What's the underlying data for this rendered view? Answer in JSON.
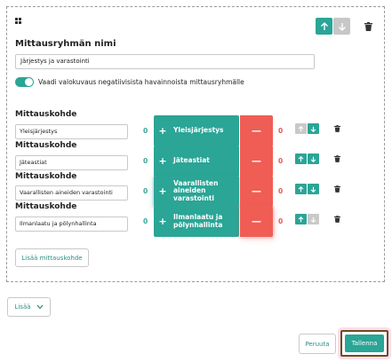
{
  "group": {
    "title": "Mittausryhmän nimi",
    "name_value": "Järjestys ja varastointi",
    "toggle_label": "Vaadi valokuvaus negatiivisista havainnoista mittausryhmälle",
    "toggle_on": true
  },
  "items": [
    {
      "label": "Mittauskohde",
      "value": "Yleisjärjestys",
      "pos_count": "0",
      "neg_count": "0",
      "button_text": "Yleisjärjestys",
      "plus": "+",
      "minus": "—"
    },
    {
      "label": "Mittauskohde",
      "value": "Jäteastiat",
      "pos_count": "0",
      "neg_count": "0",
      "button_text": "Jäteastiat",
      "plus": "+",
      "minus": "—"
    },
    {
      "label": "Mittauskohde",
      "value": "Vaarallisten aineiden varastointi",
      "pos_count": "0",
      "neg_count": "0",
      "button_text": "Vaarallisten aineiden varastointi",
      "plus": "+",
      "minus": "—"
    },
    {
      "label": "Mittauskohde",
      "value": "Ilmanlaatu ja pölynhallinta",
      "pos_count": "0",
      "neg_count": "0",
      "button_text": "Ilmanlaatu ja pölynhallinta",
      "plus": "+",
      "minus": "—"
    }
  ],
  "buttons": {
    "add_item": "Lisää mittauskohde",
    "more": "Lisää",
    "cancel": "Peruuta",
    "save": "Tallenna"
  },
  "icons": {
    "drag": "drag-handle-icon",
    "up": "arrow-up-icon",
    "down": "arrow-down-icon",
    "trash": "trash-icon",
    "chevron": "chevron-down-icon"
  },
  "colors": {
    "accent": "#2aa596",
    "negative": "#ef5d55",
    "disabled": "#c7c7c7",
    "save_outline": "#6e4a1e"
  }
}
